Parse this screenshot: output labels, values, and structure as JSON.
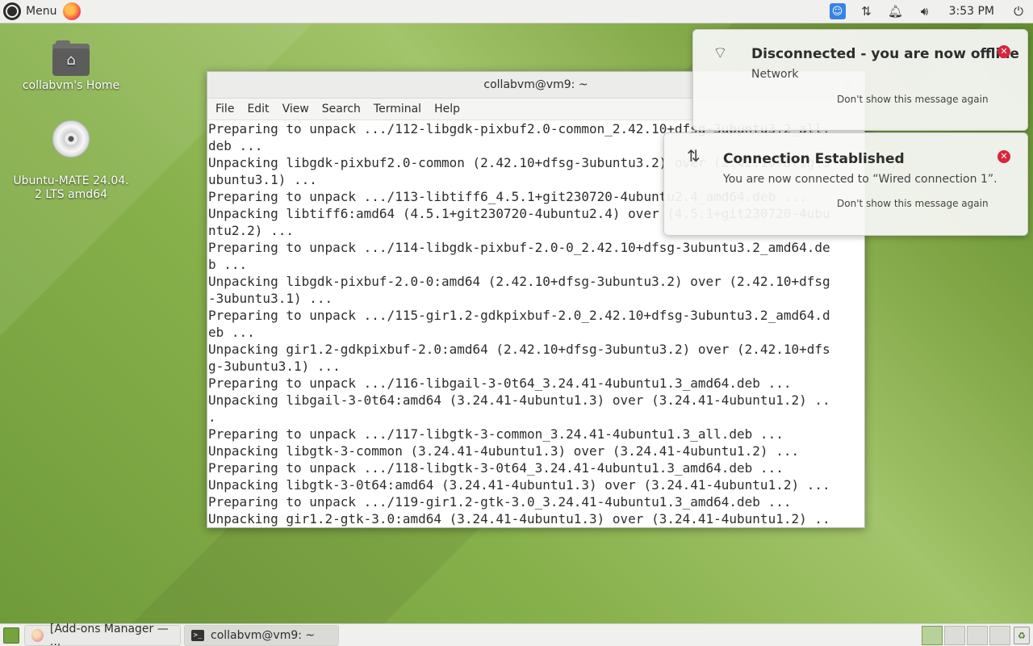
{
  "top_panel": {
    "menu_label": "Menu",
    "clock": "3:53 PM"
  },
  "desktop": {
    "home_label": "collabvm's Home",
    "disc_label": "Ubuntu-MATE 24.04.\n2 LTS amd64"
  },
  "terminal": {
    "title": "collabvm@vm9: ~",
    "menu": [
      "File",
      "Edit",
      "View",
      "Search",
      "Terminal",
      "Help"
    ],
    "lines": [
      "Preparing to unpack .../112-libgdk-pixbuf2.0-common_2.42.10+dfsg-3ubuntu3.2_all.",
      "deb ...",
      "Unpacking libgdk-pixbuf2.0-common (2.42.10+dfsg-3ubuntu3.2) over (2.42.10+dfsg-3",
      "ubuntu3.1) ...",
      "Preparing to unpack .../113-libtiff6_4.5.1+git230720-4ubuntu2.4_amd64.deb ...",
      "Unpacking libtiff6:amd64 (4.5.1+git230720-4ubuntu2.4) over (4.5.1+git230720-4ubu",
      "ntu2.2) ...",
      "Preparing to unpack .../114-libgdk-pixbuf-2.0-0_2.42.10+dfsg-3ubuntu3.2_amd64.de",
      "b ...",
      "Unpacking libgdk-pixbuf-2.0-0:amd64 (2.42.10+dfsg-3ubuntu3.2) over (2.42.10+dfsg",
      "-3ubuntu3.1) ...",
      "Preparing to unpack .../115-gir1.2-gdkpixbuf-2.0_2.42.10+dfsg-3ubuntu3.2_amd64.d",
      "eb ...",
      "Unpacking gir1.2-gdkpixbuf-2.0:amd64 (2.42.10+dfsg-3ubuntu3.2) over (2.42.10+dfs",
      "g-3ubuntu3.1) ...",
      "Preparing to unpack .../116-libgail-3-0t64_3.24.41-4ubuntu1.3_amd64.deb ...",
      "Unpacking libgail-3-0t64:amd64 (3.24.41-4ubuntu1.3) over (3.24.41-4ubuntu1.2) ..",
      ".",
      "Preparing to unpack .../117-libgtk-3-common_3.24.41-4ubuntu1.3_all.deb ...",
      "Unpacking libgtk-3-common (3.24.41-4ubuntu1.3) over (3.24.41-4ubuntu1.2) ...",
      "Preparing to unpack .../118-libgtk-3-0t64_3.24.41-4ubuntu1.3_amd64.deb ...",
      "Unpacking libgtk-3-0t64:amd64 (3.24.41-4ubuntu1.3) over (3.24.41-4ubuntu1.2) ...",
      "Preparing to unpack .../119-gir1.2-gtk-3.0_3.24.41-4ubuntu1.3_amd64.deb ...",
      "Unpacking gir1.2-gtk-3.0:amd64 (3.24.41-4ubuntu1.3) over (3.24.41-4ubuntu1.2) .."
    ]
  },
  "notifications": [
    {
      "title": "Disconnected - you are now offline",
      "body": "Network",
      "link": "Don't show this message again",
      "icon": "wifi-off-icon"
    },
    {
      "title": "Connection Established",
      "body": "You are now connected to “Wired connection 1”.",
      "link": "Don't show this message again",
      "icon": "network-wired-icon"
    }
  ],
  "taskbar": {
    "tasks": [
      "[Add-ons Manager — ...",
      "collabvm@vm9: ~"
    ]
  },
  "colors": {
    "accent": "#3584e4",
    "close_red": "#d7263d",
    "desktop_green": "#86b04a"
  }
}
